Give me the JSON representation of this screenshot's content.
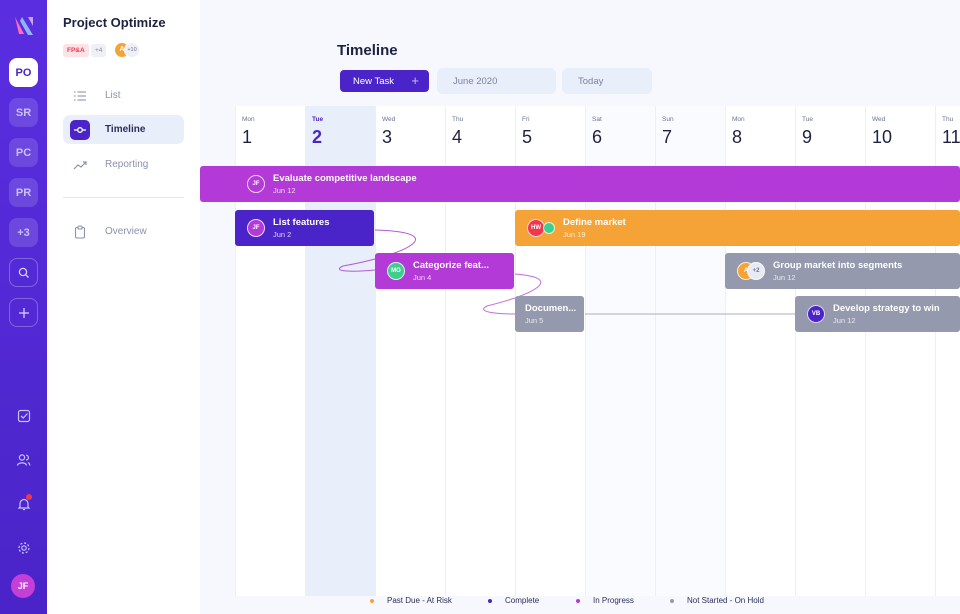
{
  "rail": {
    "workspaces": [
      {
        "label": "PO",
        "active": true
      },
      {
        "label": "SR",
        "active": false
      },
      {
        "label": "PC",
        "active": false
      },
      {
        "label": "PR",
        "active": false
      },
      {
        "label": "+3",
        "active": false
      }
    ],
    "user_initials": "JF",
    "accent": "#4a24c8"
  },
  "sidebar": {
    "project_title": "Project Optimize",
    "tag": "FP&A",
    "tag_more": "+4",
    "member_avatar_initial": "A",
    "members_more": "+10",
    "nav": [
      {
        "label": "List",
        "icon": "list-icon",
        "active": false
      },
      {
        "label": "Timeline",
        "icon": "timeline-icon",
        "active": true
      },
      {
        "label": "Reporting",
        "icon": "trend-icon",
        "active": false
      }
    ],
    "overview_label": "Overview"
  },
  "main": {
    "title": "Timeline",
    "new_task_label": "New Task",
    "month_label": "June 2020",
    "today_label": "Today"
  },
  "days": [
    {
      "name": "Mon",
      "num": "1"
    },
    {
      "name": "Tue",
      "num": "2",
      "highlight": true
    },
    {
      "name": "Wed",
      "num": "3"
    },
    {
      "name": "Thu",
      "num": "4"
    },
    {
      "name": "Fri",
      "num": "5"
    },
    {
      "name": "Sat",
      "num": "6",
      "weekend": true
    },
    {
      "name": "Sun",
      "num": "7",
      "weekend": true
    },
    {
      "name": "Mon",
      "num": "8"
    },
    {
      "name": "Tue",
      "num": "9"
    },
    {
      "name": "Wed",
      "num": "10"
    },
    {
      "name": "Thu",
      "num": "11"
    }
  ],
  "tasks": [
    {
      "title": "Evaluate competitive landscape",
      "date": "Jun 12",
      "assignee": "JF",
      "status": "In Progress"
    },
    {
      "title": "List features",
      "date": "Jun 2",
      "assignee": "JF",
      "status": "Complete"
    },
    {
      "title": "Define market",
      "date": "Jun 19",
      "assignee": "HW",
      "status": "Past Due - At Risk"
    },
    {
      "title": "Categorize feat...",
      "date": "Jun 4",
      "assignee": "MO",
      "status": "In Progress"
    },
    {
      "title": "Group market into segments",
      "date": "Jun 12",
      "assignee": "A",
      "extra": "+2",
      "status": "Not Started - On Hold"
    },
    {
      "title": "Documen...",
      "date": "Jun 5",
      "assignee": "",
      "status": "Not Started - On Hold"
    },
    {
      "title": "Develop strategy to win",
      "date": "Jun 12",
      "assignee": "VB",
      "status": "Not Started - On Hold"
    }
  ],
  "legend": [
    {
      "label": "Past Due - At Risk",
      "color": "#f5a337"
    },
    {
      "label": "Complete",
      "color": "#4a24c8"
    },
    {
      "label": "In Progress",
      "color": "#b33ad6"
    },
    {
      "label": "Not Started - On Hold",
      "color": "#9499ad"
    }
  ]
}
